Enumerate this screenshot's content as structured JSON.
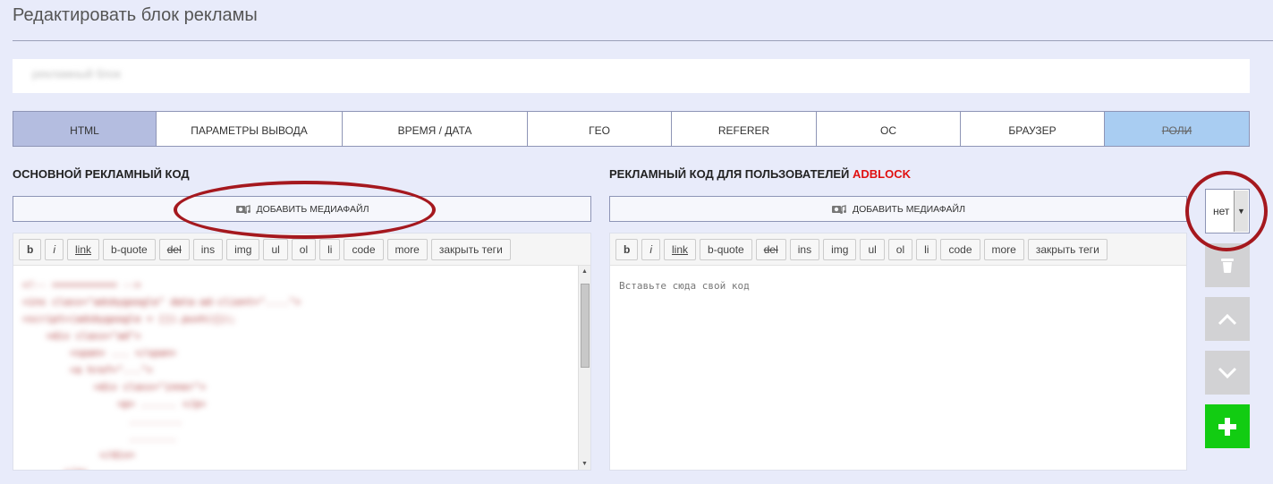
{
  "page": {
    "title": "Редактировать блок рекламы"
  },
  "name_field": {
    "value": "рекламный блок"
  },
  "tabs": [
    {
      "label": "HTML"
    },
    {
      "label": "ПАРАМЕТРЫ ВЫВОДА"
    },
    {
      "label": "ВРЕМЯ / ДАТА"
    },
    {
      "label": "ГЕО"
    },
    {
      "label": "REFERER"
    },
    {
      "label": "ОС"
    },
    {
      "label": "БРАУЗЕР"
    },
    {
      "label": "РОЛИ"
    }
  ],
  "main_section": {
    "label": "ОСНОВНОЙ РЕКЛАМНЫЙ КОД",
    "media_button": "ДОБАВИТЬ МЕДИАФАЙЛ"
  },
  "adblock_section": {
    "label_prefix": "РЕКЛАМНЫЙ КОД ДЛЯ ПОЛЬЗОВАТЕЛЕЙ ",
    "label_highlight": "ADBLOCK",
    "media_button": "ДОБАВИТЬ МЕДИАФАЙЛ",
    "placeholder": "Вставьте сюда свой код"
  },
  "quicktags": [
    "b",
    "i",
    "link",
    "b-quote",
    "del",
    "ins",
    "img",
    "ul",
    "ol",
    "li",
    "code",
    "more",
    "закрыть теги"
  ],
  "select": {
    "value": "нет"
  },
  "side_buttons": {
    "delete_icon": "trash-icon",
    "up_icon": "chevron-up-icon",
    "down_icon": "chevron-down-icon",
    "add_icon": "plus-icon"
  },
  "colors": {
    "accent_red": "#e01010",
    "add_green": "#12cc12",
    "annotation": "#a5181e"
  }
}
